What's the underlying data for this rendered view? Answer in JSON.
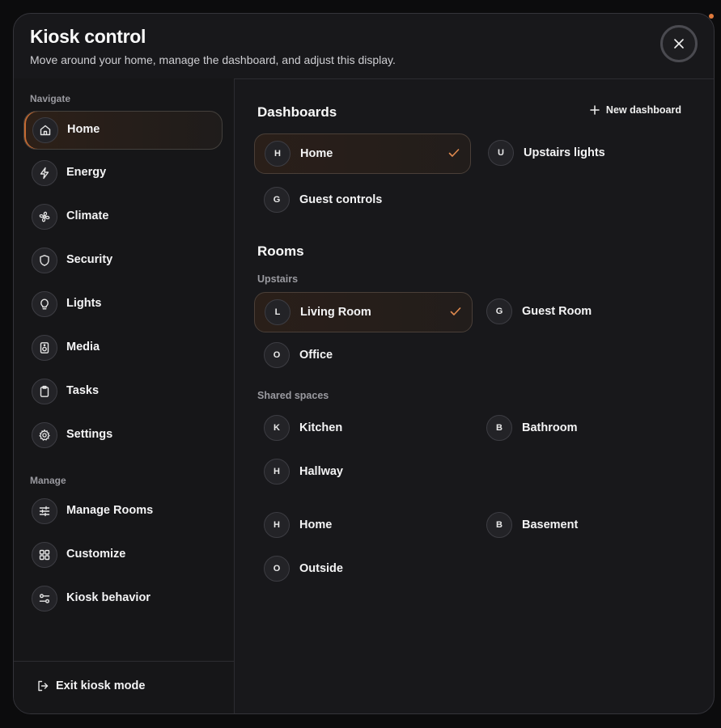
{
  "header": {
    "title": "Kiosk control",
    "subtitle": "Move around your home, manage the dashboard, and adjust this display."
  },
  "sidebar": {
    "navigate_label": "Navigate",
    "navigate_items": [
      {
        "label": "Home",
        "icon": "home-icon",
        "active": true
      },
      {
        "label": "Energy",
        "icon": "lightning-icon"
      },
      {
        "label": "Climate",
        "icon": "fan-icon"
      },
      {
        "label": "Security",
        "icon": "shield-icon"
      },
      {
        "label": "Lights",
        "icon": "lightbulb-icon"
      },
      {
        "label": "Media",
        "icon": "speaker-icon"
      },
      {
        "label": "Tasks",
        "icon": "clipboard-icon"
      },
      {
        "label": "Settings",
        "icon": "gear-icon"
      }
    ],
    "manage_label": "Manage",
    "manage_items": [
      {
        "label": "Manage Rooms",
        "icon": "sliders-icon"
      },
      {
        "label": "Customize",
        "icon": "grid-icon"
      },
      {
        "label": "Kiosk behavior",
        "icon": "toggles-icon"
      }
    ],
    "exit_label": "Exit kiosk mode"
  },
  "main": {
    "dashboards_heading": "Dashboards",
    "new_dashboard_label": "New dashboard",
    "dashboards": [
      {
        "initial": "H",
        "label": "Home",
        "selected": true
      },
      {
        "initial": "U",
        "label": "Upstairs lights"
      },
      {
        "initial": "G",
        "label": "Guest controls"
      }
    ],
    "rooms_heading": "Rooms",
    "upstairs_label": "Upstairs",
    "upstairs": [
      {
        "initial": "L",
        "label": "Living Room",
        "selected": true
      },
      {
        "initial": "G",
        "label": "Guest Room"
      },
      {
        "initial": "O",
        "label": "Office"
      }
    ],
    "shared_label": "Shared spaces",
    "shared": [
      {
        "initial": "K",
        "label": "Kitchen"
      },
      {
        "initial": "B",
        "label": "Bathroom"
      },
      {
        "initial": "H",
        "label": "Hallway"
      }
    ],
    "other": [
      {
        "initial": "H",
        "label": "Home"
      },
      {
        "initial": "B",
        "label": "Basement"
      },
      {
        "initial": "O",
        "label": "Outside"
      }
    ]
  },
  "colors": {
    "accent": "#e08a4f",
    "background": "#18181b"
  }
}
